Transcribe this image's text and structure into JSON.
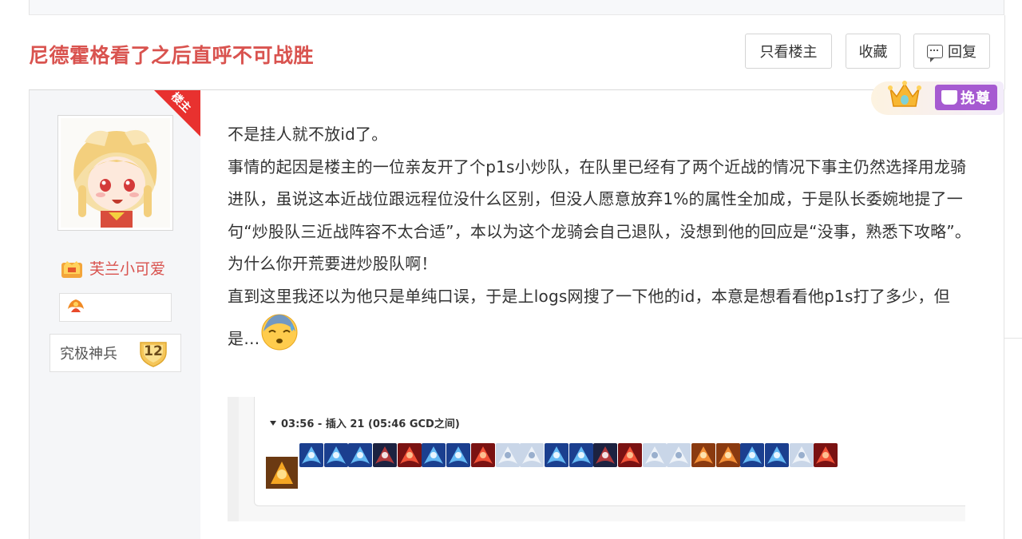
{
  "thread": {
    "title": "尼德霍格看了之后直呼不可战胜"
  },
  "toolbar": {
    "only_op_label": "只看楼主",
    "favorite_label": "收藏",
    "reply_label": "回复"
  },
  "author": {
    "op_tag": "楼主",
    "username": "芙兰小可爱",
    "level_title": "究极神兵",
    "level": "12"
  },
  "user_tag": {
    "label": "挽尊"
  },
  "post": {
    "lines": [
      "不是挂人就不放id了。",
      "事情的起因是楼主的一位亲友开了个p1s小炒队，在队里已经有了两个近战的情况下事主仍然选择用龙骑进队，虽说这本近战位跟远程位没什么区别，但没人愿意放弃1%的属性全加成，于是队长委婉地提了一句“炒股队三近战阵容不太合适”，本以为这个龙骑会自己退队，没想到他的回应是“没事，熟悉下攻略”。",
      "为什么你开荒要进炒股队啊！",
      "直到这里我还以为他只是单纯口误，于是上logs网搜了一下他的id，本意是想看看他p1s打了多少，但是…"
    ]
  },
  "embed": {
    "title": "03:56 - 插入 21 (05:46 GCD之间)",
    "skills": [
      "blue",
      "blue",
      "blue",
      "dark",
      "red",
      "blue",
      "blue",
      "red",
      "pale",
      "pale",
      "blue",
      "blue",
      "dark",
      "red",
      "pale",
      "pale",
      "orange",
      "orange",
      "blue",
      "blue",
      "pale",
      "red"
    ]
  },
  "colors": {
    "title_red": "#d9534f",
    "op_ribbon": "#e8312f",
    "tag_purple": "#a65ad1"
  }
}
